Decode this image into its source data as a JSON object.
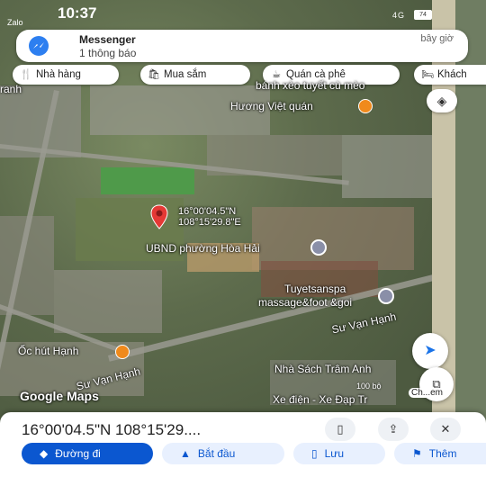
{
  "status": {
    "time": "10:37",
    "app": "Zalo",
    "indicators": "4G",
    "battery": "74"
  },
  "notification": {
    "app": "Messenger",
    "body": "1 thông báo",
    "time": "bây giờ"
  },
  "chips": [
    {
      "label": "Nhà hàng",
      "icon": "restaurant-icon"
    },
    {
      "label": "Mua sắm",
      "icon": "shopping-icon"
    },
    {
      "label": "Quán cà phê",
      "icon": "coffee-icon"
    },
    {
      "label": "Khách",
      "icon": "hotel-icon"
    }
  ],
  "map": {
    "labels": {
      "banh_xeo": "bánh xèo tuyết cù mèo",
      "huong_viet": "Hương Việt quán",
      "ubnd": "UBND phường Hòa Hải",
      "spa_1": "Tuyetsanspa",
      "spa_2": "massage&foot &goi",
      "street_1": "Sư Vạn Hạnh",
      "street_2": "Sư Vạn Hạnh",
      "oc_hut": "Ốc hút Hạnh",
      "nha_sach": "Nhà Sách Trâm Anh",
      "xe_dien": "Xe điện - Xe Đạp Tr",
      "transit_left": "ranh"
    },
    "pin_coords_line1": "16°00'04.5\"N",
    "pin_coords_line2": "108°15'29.8\"E",
    "logo": "Google Maps",
    "scale": "100 bộ",
    "fab_label": "Ch...em"
  },
  "sheet": {
    "title": "16°00'04.5\"N 108°15'29....",
    "actions": [
      {
        "label": "Đường đi",
        "icon": "directions-icon"
      },
      {
        "label": "Bắt đầu",
        "icon": "navigation-icon"
      },
      {
        "label": "Lưu",
        "icon": "bookmark-icon"
      },
      {
        "label": "Thêm",
        "icon": "flag-icon"
      }
    ]
  },
  "colors": {
    "accent": "#1a73e8",
    "directions_bg": "#0b57d0",
    "chip_bg": "#ffffff",
    "pin": "#e53935",
    "poi_orange": "#f08a1c"
  }
}
